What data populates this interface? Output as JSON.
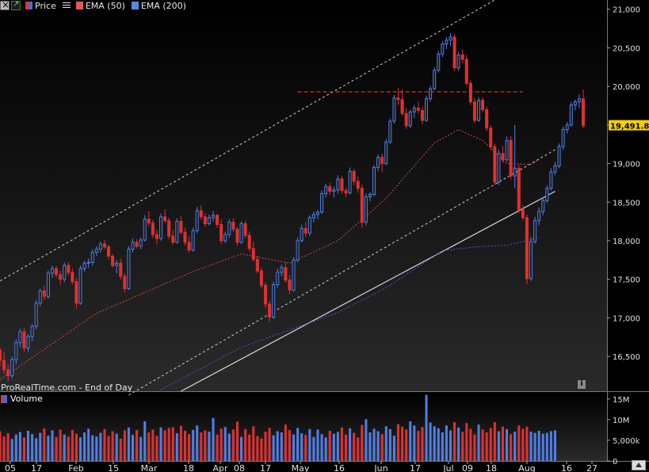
{
  "legend": {
    "price_label": "Price",
    "ema50_label": "EMA (50)",
    "ema200_label": "EMA (200)"
  },
  "source_text": "ProRealTime.com - End of Day",
  "info_icon": "i",
  "volume_title": "Volume",
  "last_price_label": "19,491.84",
  "colors": {
    "up": "#4f7fe6",
    "down": "#e03030",
    "ema50": "#d04a4a",
    "ema200": "#3a5fd0",
    "channel": "#cfcfcf",
    "trendline": "#d8d8d8",
    "resistance": "#e02020",
    "price_badge": "#f5d000"
  },
  "chart_data": {
    "type": "candlestick",
    "ylim": [
      16050,
      21120
    ],
    "y_ticks": [
      "21,000",
      "20,500",
      "20,000",
      "19,500",
      "19,000",
      "18,500",
      "18,000",
      "17,500",
      "17,000",
      "16,500"
    ],
    "x_ticks": [
      "05",
      "17",
      "Feb",
      "15",
      "Mar",
      "18",
      "Apr",
      "08",
      "17",
      "May",
      "16",
      "Jun",
      "17",
      "Jul",
      "09",
      "18",
      "Aug",
      "16",
      "27"
    ],
    "last_price": 19491.84,
    "resistance_level": 19930,
    "candles": [
      [
        16580,
        16620,
        16380,
        16450
      ],
      [
        16450,
        16560,
        16280,
        16330
      ],
      [
        16330,
        16400,
        16180,
        16250
      ],
      [
        16250,
        16500,
        16220,
        16460
      ],
      [
        16460,
        16720,
        16400,
        16680
      ],
      [
        16680,
        16860,
        16620,
        16820
      ],
      [
        16820,
        16870,
        16560,
        16610
      ],
      [
        16610,
        16790,
        16560,
        16760
      ],
      [
        16760,
        16920,
        16700,
        16890
      ],
      [
        16890,
        17230,
        16850,
        17190
      ],
      [
        17190,
        17380,
        17150,
        17350
      ],
      [
        17350,
        17420,
        17230,
        17280
      ],
      [
        17280,
        17620,
        17250,
        17580
      ],
      [
        17580,
        17680,
        17520,
        17640
      ],
      [
        17640,
        17670,
        17520,
        17560
      ],
      [
        17560,
        17610,
        17430,
        17500
      ],
      [
        17500,
        17720,
        17460,
        17680
      ],
      [
        17680,
        17720,
        17550,
        17590
      ],
      [
        17590,
        17640,
        17430,
        17470
      ],
      [
        17470,
        17520,
        17120,
        17190
      ],
      [
        17190,
        17680,
        17170,
        17640
      ],
      [
        17640,
        17740,
        17600,
        17710
      ],
      [
        17710,
        17770,
        17650,
        17720
      ],
      [
        17720,
        17890,
        17680,
        17850
      ],
      [
        17850,
        17930,
        17800,
        17890
      ],
      [
        17890,
        17990,
        17850,
        17960
      ],
      [
        17960,
        18010,
        17890,
        17920
      ],
      [
        17920,
        17950,
        17760,
        17800
      ],
      [
        17800,
        17830,
        17650,
        17680
      ],
      [
        17680,
        17750,
        17580,
        17710
      ],
      [
        17710,
        17770,
        17500,
        17540
      ],
      [
        17540,
        17580,
        17330,
        17380
      ],
      [
        17380,
        17930,
        17360,
        17890
      ],
      [
        17890,
        18030,
        17850,
        17980
      ],
      [
        17980,
        18020,
        17900,
        17930
      ],
      [
        17930,
        18040,
        17890,
        18010
      ],
      [
        18010,
        18330,
        17990,
        18280
      ],
      [
        18280,
        18380,
        18180,
        18230
      ],
      [
        18230,
        18270,
        18040,
        18080
      ],
      [
        18080,
        18140,
        17950,
        18030
      ],
      [
        18030,
        18350,
        18000,
        18310
      ],
      [
        18310,
        18410,
        18230,
        18260
      ],
      [
        18260,
        18300,
        18020,
        18060
      ],
      [
        18060,
        18140,
        17950,
        17980
      ],
      [
        17980,
        18290,
        17960,
        18250
      ],
      [
        18250,
        18320,
        18080,
        18110
      ],
      [
        18110,
        18170,
        17940,
        17980
      ],
      [
        17980,
        18060,
        17850,
        17880
      ],
      [
        17880,
        18170,
        17860,
        18130
      ],
      [
        18130,
        18440,
        18100,
        18390
      ],
      [
        18390,
        18460,
        18270,
        18310
      ],
      [
        18310,
        18360,
        18180,
        18220
      ],
      [
        18220,
        18340,
        18200,
        18300
      ],
      [
        18300,
        18390,
        18250,
        18330
      ],
      [
        18330,
        18350,
        18170,
        18210
      ],
      [
        18210,
        18280,
        17960,
        18000
      ],
      [
        18000,
        18120,
        17970,
        18080
      ],
      [
        18080,
        18280,
        18040,
        18240
      ],
      [
        18240,
        18290,
        18110,
        18150
      ],
      [
        18150,
        18180,
        17930,
        17980
      ],
      [
        17980,
        18250,
        17960,
        18220
      ],
      [
        18220,
        18260,
        18030,
        18070
      ],
      [
        18070,
        18120,
        17860,
        17900
      ],
      [
        17900,
        17990,
        17730,
        17760
      ],
      [
        17760,
        17800,
        17580,
        17610
      ],
      [
        17610,
        17650,
        17390,
        17420
      ],
      [
        17420,
        17460,
        17130,
        17180
      ],
      [
        17180,
        17220,
        16950,
        17010
      ],
      [
        17010,
        17470,
        16990,
        17430
      ],
      [
        17430,
        17640,
        17390,
        17590
      ],
      [
        17590,
        17690,
        17540,
        17650
      ],
      [
        17650,
        17720,
        17460,
        17490
      ],
      [
        17490,
        17560,
        17310,
        17360
      ],
      [
        17360,
        17790,
        17340,
        17750
      ],
      [
        17750,
        18040,
        17720,
        18000
      ],
      [
        18000,
        18210,
        17980,
        18160
      ],
      [
        18160,
        18240,
        18050,
        18100
      ],
      [
        18100,
        18330,
        18060,
        18300
      ],
      [
        18300,
        18380,
        18240,
        18340
      ],
      [
        18340,
        18400,
        18280,
        18370
      ],
      [
        18370,
        18650,
        18350,
        18610
      ],
      [
        18610,
        18740,
        18560,
        18700
      ],
      [
        18700,
        18750,
        18590,
        18640
      ],
      [
        18640,
        18700,
        18560,
        18660
      ],
      [
        18660,
        18850,
        18610,
        18800
      ],
      [
        18800,
        18840,
        18610,
        18650
      ],
      [
        18650,
        18690,
        18560,
        18620
      ],
      [
        18620,
        18950,
        18600,
        18900
      ],
      [
        18900,
        18930,
        18720,
        18770
      ],
      [
        18770,
        18830,
        18620,
        18680
      ],
      [
        18680,
        18730,
        18170,
        18240
      ],
      [
        18240,
        18610,
        18200,
        18570
      ],
      [
        18570,
        18630,
        18510,
        18600
      ],
      [
        18600,
        18980,
        18580,
        18950
      ],
      [
        18950,
        19120,
        18900,
        19080
      ],
      [
        19080,
        19130,
        18890,
        19000
      ],
      [
        19000,
        19320,
        18980,
        19280
      ],
      [
        19280,
        19580,
        19250,
        19550
      ],
      [
        19550,
        19890,
        19520,
        19850
      ],
      [
        19850,
        19980,
        19760,
        19830
      ],
      [
        19830,
        19960,
        19620,
        19650
      ],
      [
        19650,
        19720,
        19450,
        19490
      ],
      [
        19490,
        19700,
        19460,
        19670
      ],
      [
        19670,
        19760,
        19590,
        19720
      ],
      [
        19720,
        19800,
        19650,
        19690
      ],
      [
        19690,
        19730,
        19510,
        19560
      ],
      [
        19560,
        19880,
        19540,
        19840
      ],
      [
        19840,
        20010,
        19800,
        19970
      ],
      [
        19970,
        20250,
        19950,
        20210
      ],
      [
        20210,
        20460,
        20180,
        20420
      ],
      [
        20420,
        20590,
        20380,
        20550
      ],
      [
        20550,
        20640,
        20480,
        20600
      ],
      [
        20600,
        20690,
        20520,
        20640
      ],
      [
        20640,
        20670,
        20200,
        20240
      ],
      [
        20240,
        20450,
        20200,
        20410
      ],
      [
        20410,
        20480,
        20300,
        20350
      ],
      [
        20350,
        20410,
        20010,
        20040
      ],
      [
        20040,
        20080,
        19760,
        19800
      ],
      [
        19800,
        19850,
        19520,
        19560
      ],
      [
        19560,
        19860,
        19540,
        19820
      ],
      [
        19820,
        19860,
        19660,
        19700
      ],
      [
        19700,
        19740,
        19420,
        19460
      ],
      [
        19460,
        19500,
        19180,
        19220
      ],
      [
        19220,
        19260,
        18730,
        18760
      ],
      [
        18760,
        19180,
        18720,
        19130
      ],
      [
        19130,
        19230,
        19010,
        19050
      ],
      [
        19050,
        19350,
        19020,
        19300
      ],
      [
        19300,
        19360,
        18800,
        18840
      ],
      [
        18840,
        19500,
        18680,
        18940
      ],
      [
        18940,
        18990,
        18360,
        18400
      ],
      [
        18400,
        18460,
        18260,
        18300
      ],
      [
        18300,
        18340,
        17440,
        17510
      ],
      [
        17510,
        18050,
        17480,
        17990
      ],
      [
        17990,
        18310,
        17960,
        18260
      ],
      [
        18260,
        18430,
        18200,
        18380
      ],
      [
        18380,
        18560,
        18330,
        18520
      ],
      [
        18520,
        18720,
        18490,
        18680
      ],
      [
        18680,
        18940,
        18650,
        18890
      ],
      [
        18890,
        19020,
        18850,
        18970
      ],
      [
        18970,
        19260,
        18940,
        19220
      ],
      [
        19220,
        19480,
        19180,
        19440
      ],
      [
        19440,
        19540,
        19390,
        19500
      ],
      [
        19500,
        19800,
        19480,
        19760
      ],
      [
        19760,
        19830,
        19690,
        19800
      ],
      [
        19800,
        19900,
        19720,
        19840
      ],
      [
        19840,
        19960,
        19460,
        19492
      ]
    ],
    "ema50": [
      [
        0,
        16200
      ],
      [
        24,
        17060
      ],
      [
        48,
        17600
      ],
      [
        60,
        17830
      ],
      [
        67,
        17760
      ],
      [
        72,
        17710
      ],
      [
        84,
        18000
      ],
      [
        96,
        18550
      ],
      [
        108,
        19270
      ],
      [
        114,
        19440
      ],
      [
        120,
        19300
      ],
      [
        126,
        19000
      ],
      [
        132,
        18990
      ],
      [
        134,
        19050
      ]
    ],
    "ema200": [
      [
        40,
        16070
      ],
      [
        60,
        16620
      ],
      [
        84,
        17070
      ],
      [
        96,
        17390
      ],
      [
        110,
        17870
      ],
      [
        118,
        17920
      ],
      [
        126,
        17940
      ],
      [
        134,
        18040
      ]
    ],
    "volume": {
      "ylim": [
        0,
        16500000
      ],
      "y_ticks": [
        "15M",
        "10M",
        "5,000k",
        "0"
      ],
      "values": [
        7.2,
        5.9,
        6.7,
        5.3,
        6.4,
        7.0,
        5.7,
        7.3,
        6.5,
        5.5,
        6.8,
        7.9,
        6.1,
        7.4,
        5.8,
        7.6,
        6.4,
        5.9,
        7.5,
        6.6,
        5.7,
        6.9,
        7.8,
        6.2,
        5.9,
        6.8,
        7.7,
        6.0,
        7.2,
        6.6,
        5.4,
        7.4,
        8.1,
        6.3,
        7.5,
        5.8,
        9.6,
        6.9,
        7.6,
        6.1,
        8.1,
        7.4,
        8.0,
        8.2,
        6.7,
        8.5,
        7.3,
        6.5,
        7.5,
        8.6,
        6.9,
        7.4,
        7.1,
        10.4,
        6.4,
        7.8,
        8.2,
        6.6,
        7.6,
        9.5,
        5.8,
        7.7,
        6.4,
        8.4,
        6.0,
        5.4,
        7.1,
        8.0,
        6.2,
        7.2,
        6.9,
        8.8,
        7.5,
        6.4,
        8.0,
        6.7,
        6.3,
        7.7,
        5.8,
        7.6,
        6.5,
        5.7,
        7.3,
        6.6,
        7.0,
        8.1,
        6.4,
        7.9,
        6.8,
        5.7,
        8.7,
        10.1,
        6.9,
        7.8,
        7.2,
        6.5,
        8.4,
        7.7,
        6.1,
        8.9,
        8.3,
        7.6,
        9.6,
        8.6,
        7.3,
        8.2,
        16.0,
        9.3,
        8.4,
        7.9,
        6.9,
        8.6,
        7.4,
        9.4,
        8.1,
        7.0,
        9.2,
        7.8,
        6.4,
        8.8,
        7.6,
        6.9,
        8.0,
        9.4,
        7.2,
        8.3,
        7.7,
        6.5,
        7.1,
        8.6,
        7.8,
        8.3,
        7.1,
        6.8,
        7.3,
        6.6,
        6.8,
        7.2,
        7.4
      ]
    }
  }
}
